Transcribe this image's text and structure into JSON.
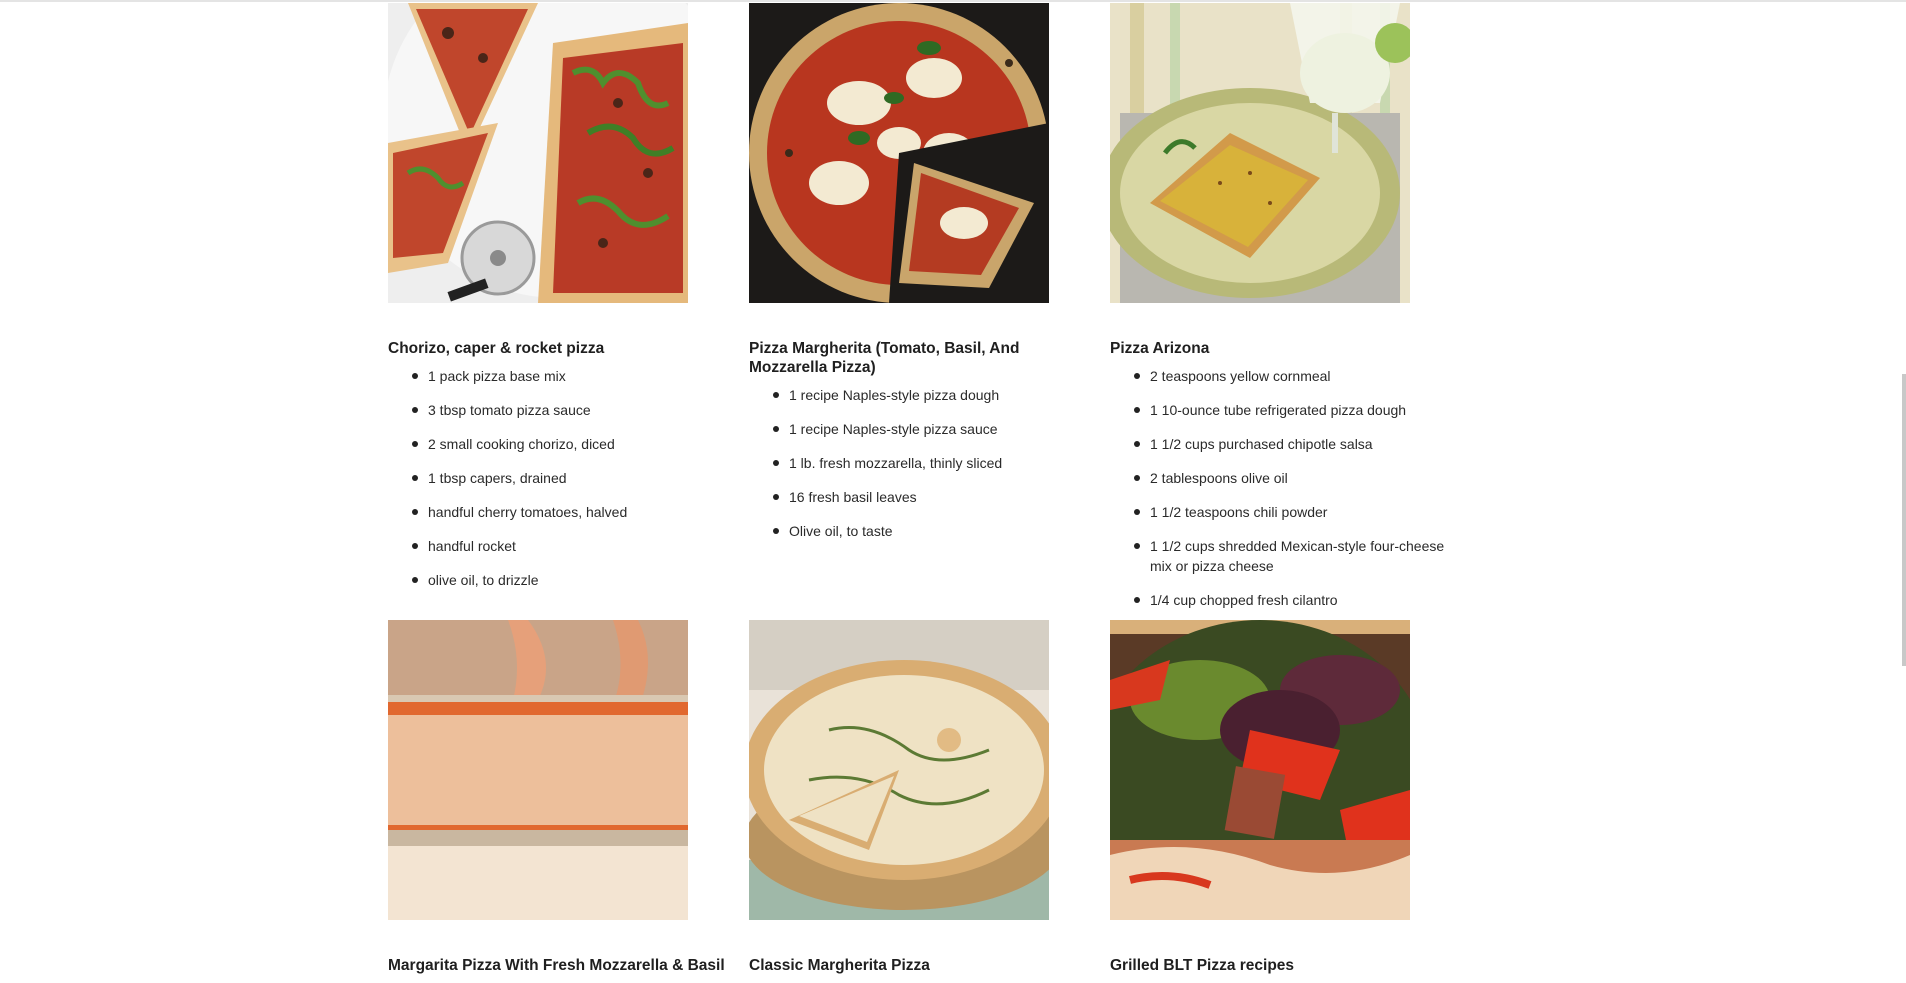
{
  "recipes": [
    {
      "title": "Chorizo, caper & rocket pizza",
      "image": "pizza-slices-with-rocket-and-cutter-photo",
      "ingredients": [
        "1 pack pizza base mix",
        "3 tbsp tomato pizza sauce",
        "2 small cooking chorizo, diced",
        "1 tbsp capers, drained",
        "handful cherry tomatoes, halved",
        "handful rocket",
        "olive oil, to drizzle"
      ]
    },
    {
      "title": "Pizza Margherita (Tomato, Basil, And Mozzarella Pizza)",
      "image": "neapolitan-margherita-pizza-photo",
      "ingredients": [
        "1 recipe Naples-style pizza dough",
        "1 recipe Naples-style pizza sauce",
        "1 lb. fresh mozzarella, thinly sliced",
        "16 fresh basil leaves",
        "Olive oil, to taste"
      ]
    },
    {
      "title": "Pizza Arizona",
      "image": "square-pizza-slice-with-margarita-photo",
      "ingredients": [
        "2 teaspoons yellow cornmeal",
        "1 10-ounce tube refrigerated pizza dough",
        "1 1/2 cups purchased chipotle salsa",
        "2 tablespoons olive oil",
        "1 1/2 teaspoons chili powder",
        "1 1/2 cups shredded Mexican-style four-cheese mix or pizza cheese",
        "1/4 cup chopped fresh cilantro"
      ]
    },
    {
      "title": "Margarita Pizza With Fresh Mozzarella & Basil",
      "image": "sheet-pan-pizza-with-cheese-photo",
      "ingredients": []
    },
    {
      "title": "Classic Margherita Pizza",
      "image": "sliced-margherita-pizza-on-board-photo",
      "ingredients": []
    },
    {
      "title": "Grilled BLT Pizza recipes",
      "image": "grilled-blt-pizza-closeup-photo",
      "ingredients": []
    }
  ]
}
